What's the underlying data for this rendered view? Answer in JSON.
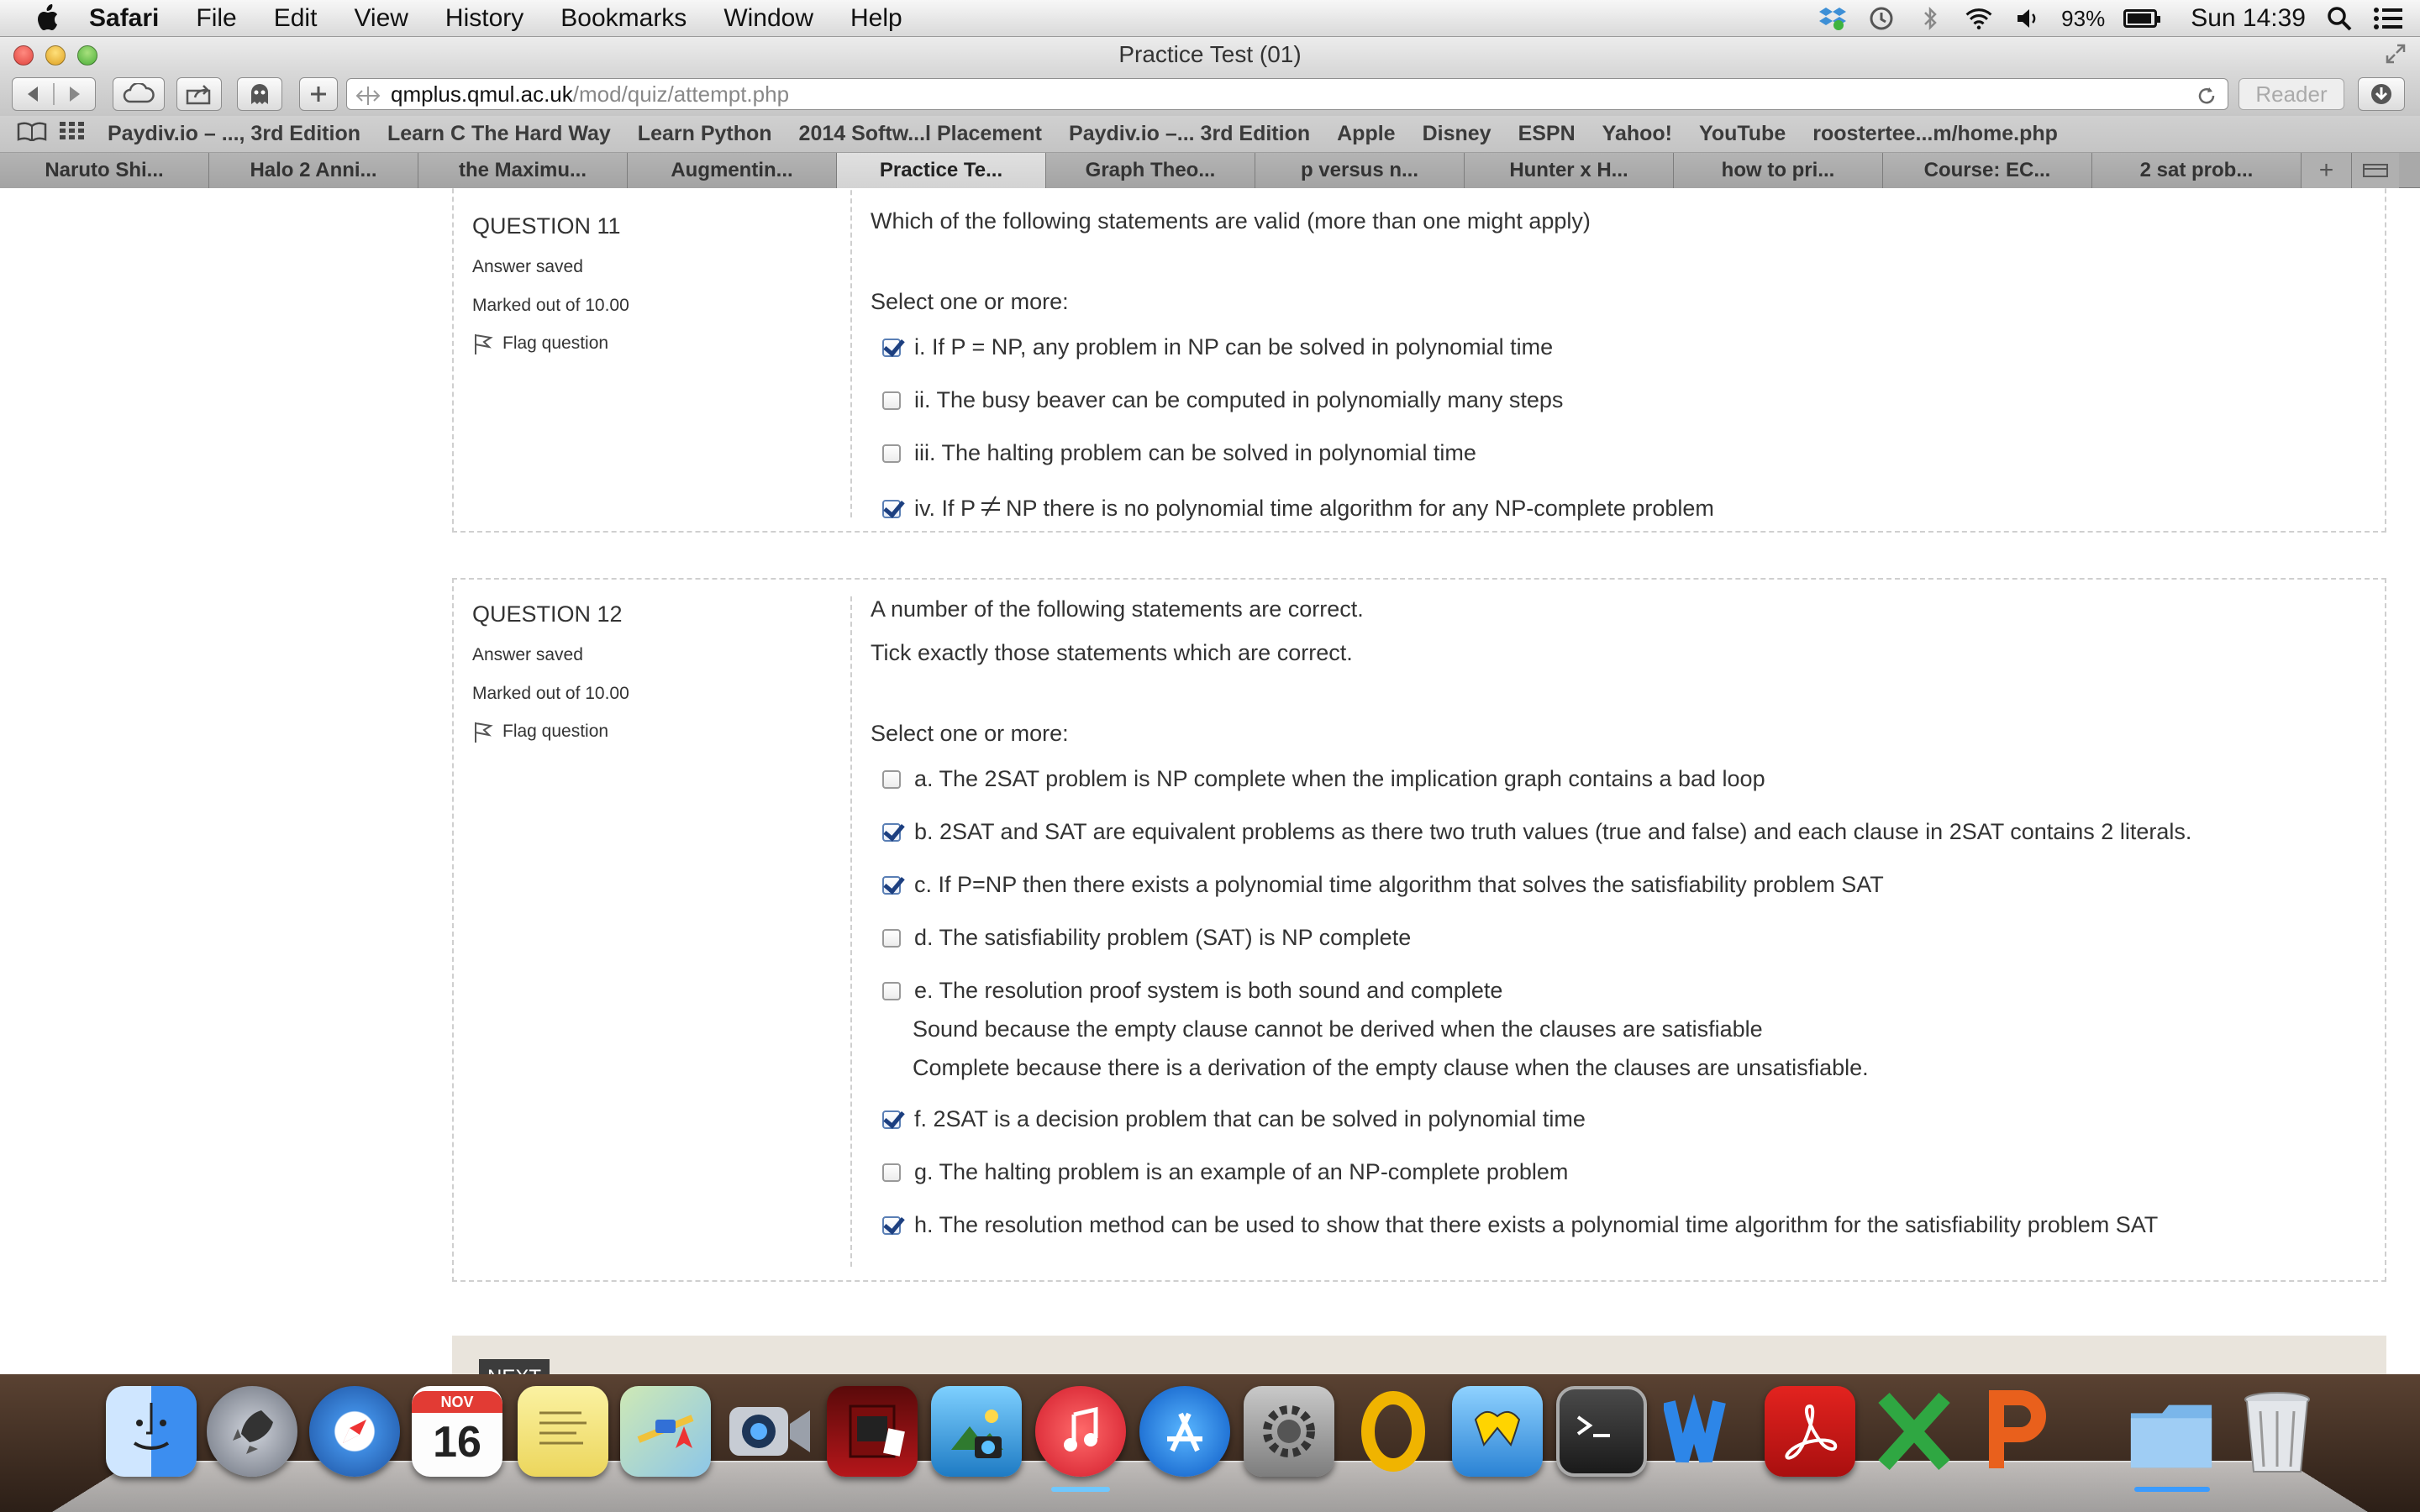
{
  "menubar": {
    "app": "Safari",
    "items": [
      "File",
      "Edit",
      "View",
      "History",
      "Bookmarks",
      "Window",
      "Help"
    ],
    "battery": "93%",
    "clock": "Sun 14:39"
  },
  "window": {
    "title": "Practice Test (01)",
    "url_host": "qmplus.qmul.ac.uk",
    "url_path": "/mod/quiz/attempt.php",
    "reader_label": "Reader"
  },
  "bookmarks": [
    "Paydiv.io – ..., 3rd Edition",
    "Learn C The Hard Way",
    "Learn Python",
    "2014 Softw...l Placement",
    "Paydiv.io –... 3rd Edition",
    "Apple",
    "Disney",
    "ESPN",
    "Yahoo!",
    "YouTube",
    "roostertee...m/home.php"
  ],
  "tabs": [
    {
      "label": "Naruto Shi...",
      "active": false
    },
    {
      "label": "Halo 2 Anni...",
      "active": false
    },
    {
      "label": "the Maximu...",
      "active": false
    },
    {
      "label": "Augmentin...",
      "active": false
    },
    {
      "label": "Practice Te...",
      "active": true
    },
    {
      "label": "Graph Theo...",
      "active": false
    },
    {
      "label": "p versus n...",
      "active": false
    },
    {
      "label": "Hunter x H...",
      "active": false
    },
    {
      "label": "how to pri...",
      "active": false
    },
    {
      "label": "Course: EC...",
      "active": false
    },
    {
      "label": "2 sat prob...",
      "active": false
    }
  ],
  "q11": {
    "title": "QUESTION 11",
    "status": "Answer saved",
    "marks": "Marked out of 10.00",
    "flag": "Flag question",
    "prompt": "Which of the following statements are valid (more than one might apply)",
    "select_label": "Select one or more:",
    "options": [
      {
        "label": "i. If P = NP, any problem in NP can be solved in polynomial time",
        "checked": true
      },
      {
        "label": "ii. The busy beaver can be computed in polynomially many steps",
        "checked": false
      },
      {
        "label": "iii. The halting problem can be solved in polynomial time",
        "checked": false
      },
      {
        "label_pre": "iv. If P",
        "label_post": "NP there is no polynomial time algorithm for any NP-complete problem",
        "checked": true
      }
    ]
  },
  "q12": {
    "title": "QUESTION 12",
    "status": "Answer saved",
    "marks": "Marked out of 10.00",
    "flag": "Flag question",
    "prompt1": "A number of the following statements are correct.",
    "prompt2": "Tick exactly those statements which are correct.",
    "select_label": "Select one or more:",
    "options": [
      {
        "label": "a. The 2SAT problem is NP complete when the implication graph contains a bad loop",
        "checked": false
      },
      {
        "label": "b. 2SAT and SAT are equivalent problems as there two truth values (true and false) and each clause in 2SAT contains 2 literals.",
        "checked": true
      },
      {
        "label": "c. If P=NP then there exists a polynomial time algorithm that solves the satisfiability problem SAT",
        "checked": true
      },
      {
        "label": "d. The satisfiability problem (SAT) is NP complete",
        "checked": false
      },
      {
        "label": "e. The resolution proof system is both sound and complete",
        "checked": false,
        "extra1": "Sound because the empty clause cannot be derived when the clauses are satisfiable",
        "extra2": "Complete because there is a derivation of the empty clause when the clauses are unsatisfiable."
      },
      {
        "label": "f. 2SAT is a decision problem that can be solved in polynomial time",
        "checked": true
      },
      {
        "label": "g. The halting problem is an example of an NP-complete problem",
        "checked": false
      },
      {
        "label": "h. The resolution method can be used to show that there exists a polynomial time algorithm for the satisfiability problem SAT",
        "checked": true
      }
    ]
  },
  "next_label": "NEXT",
  "dock": {
    "calendar_month": "NOV",
    "calendar_day": "16",
    "apps": [
      "finder",
      "launchpad",
      "safari",
      "calendar",
      "stickies",
      "maps",
      "facetime",
      "photo-booth",
      "iphoto",
      "itunes",
      "app-store",
      "system-preferences",
      "outlook",
      "codeblocks",
      "terminal",
      "word",
      "acrobat",
      "excel",
      "powerpoint",
      "downloads-folder",
      "trash"
    ]
  }
}
